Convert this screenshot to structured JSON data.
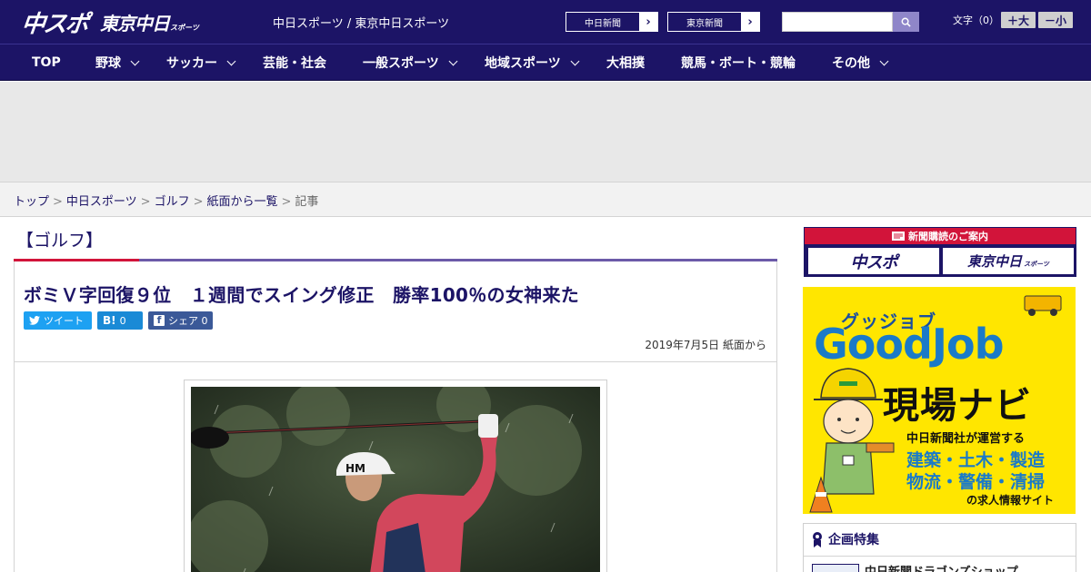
{
  "header": {
    "logo_main": "中スポ",
    "logo_sub": "東京中日",
    "logo_sub_small": "スポーツ",
    "tagline": "中日スポーツ / 東京中日スポーツ",
    "ext_links": [
      {
        "label": "中日新聞"
      },
      {
        "label": "東京新聞"
      }
    ],
    "text_size_label": "文字（0）",
    "size_up": "＋大",
    "size_down": "－小"
  },
  "nav": {
    "items": [
      {
        "label": "TOP",
        "has_dropdown": false
      },
      {
        "label": "野球",
        "has_dropdown": true
      },
      {
        "label": "サッカー",
        "has_dropdown": true
      },
      {
        "label": "芸能・社会",
        "has_dropdown": false
      },
      {
        "label": "一般スポーツ",
        "has_dropdown": true
      },
      {
        "label": "地域スポーツ",
        "has_dropdown": true
      },
      {
        "label": "大相撲",
        "has_dropdown": false
      },
      {
        "label": "競馬・ボート・競輪",
        "has_dropdown": false
      },
      {
        "label": "その他",
        "has_dropdown": true
      }
    ]
  },
  "breadcrumb": {
    "items": [
      "トップ",
      "中日スポーツ",
      "ゴルフ",
      "紙面から一覧"
    ],
    "current": "記事",
    "separator": ">"
  },
  "article": {
    "category": "【ゴルフ】",
    "title": "ボミＶ字回復９位　１週間でスイング修正　勝率100％の女神来た",
    "share": {
      "tweet_label": "ツイート",
      "hatena_label": "B!",
      "hatena_count": "0",
      "facebook_label": "シェア",
      "facebook_count": "0"
    },
    "dateline": "2019年7月5日 紙面から"
  },
  "sidebar": {
    "subscription": {
      "header": "新聞購読のご案内",
      "logo1": "中スポ",
      "logo2": "東京中日",
      "logo2_small": "スポーツ"
    },
    "goodjob": {
      "kana": "グッジョブ",
      "main": "GoodJob",
      "navi": "現場ナビ",
      "line1": "中日新聞社が運営する",
      "line2": "建築・土木・製造",
      "line3": "物流・警備・清掃",
      "line4": "の求人情報サイト"
    },
    "feature": {
      "heading": "企画特集",
      "item": "中日新聞ドラゴンズショップ"
    }
  },
  "colors": {
    "brand_navy": "#1c1466",
    "accent_red": "#d2143a",
    "accent_purple": "#6b5aa8",
    "twitter": "#1da1f2",
    "hatena": "#1a8ad6",
    "facebook": "#3b5998",
    "goodjob_yellow": "#ffe600",
    "goodjob_blue": "#1a7ac8"
  }
}
